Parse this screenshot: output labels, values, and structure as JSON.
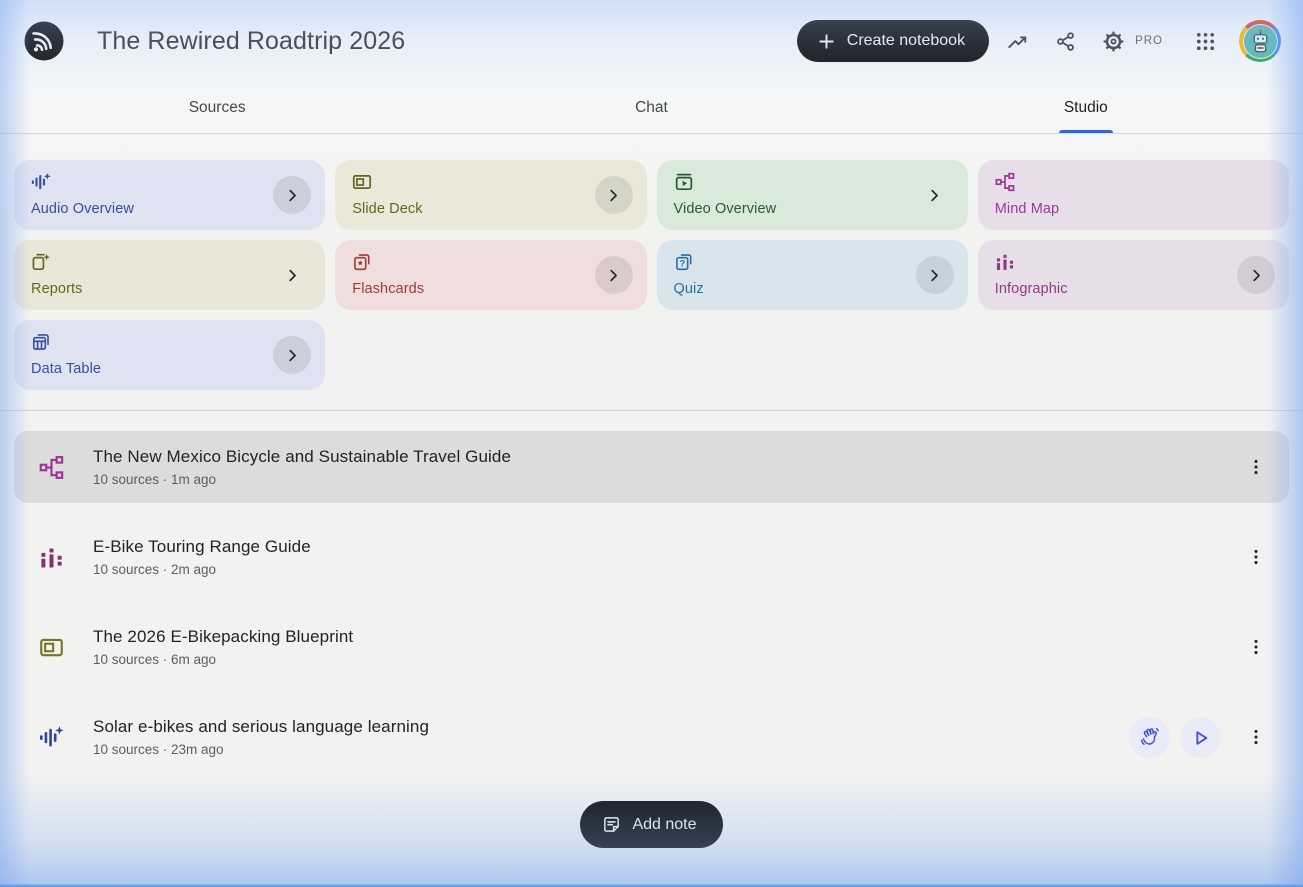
{
  "header": {
    "title": "The Rewired Roadtrip 2026",
    "create_notebook_label": "Create notebook",
    "pro_badge": "PRO"
  },
  "tabs": [
    {
      "label": "Sources",
      "active": false
    },
    {
      "label": "Chat",
      "active": false
    },
    {
      "label": "Studio",
      "active": true
    }
  ],
  "studio_cards": [
    {
      "label": "Audio Overview",
      "icon": "audio-overview-icon",
      "bg": "#dfe2f1",
      "fg": "#3a4e94",
      "chevron": "circle"
    },
    {
      "label": "Slide Deck",
      "icon": "slide-deck-icon",
      "bg": "#e9e8d9",
      "fg": "#6b6420",
      "chevron": "circle"
    },
    {
      "label": "Video Overview",
      "icon": "video-overview-icon",
      "bg": "#d9e9da",
      "fg": "#2c5932",
      "chevron": "plain"
    },
    {
      "label": "Mind Map",
      "icon": "mind-map-icon",
      "bg": "#e8dee8",
      "fg": "#99399a",
      "chevron": "none"
    },
    {
      "label": "Reports",
      "icon": "reports-icon",
      "bg": "#e8e7d8",
      "fg": "#6b6420",
      "chevron": "plain"
    },
    {
      "label": "Flashcards",
      "icon": "flashcards-icon",
      "bg": "#f0dddd",
      "fg": "#9e3b38",
      "chevron": "circle"
    },
    {
      "label": "Quiz",
      "icon": "quiz-icon",
      "bg": "#d8e5ed",
      "fg": "#2b6f9e",
      "chevron": "circle"
    },
    {
      "label": "Infographic",
      "icon": "infographic-icon",
      "bg": "#e7dfe7",
      "fg": "#8f3a88",
      "chevron": "circle"
    },
    {
      "label": "Data Table",
      "icon": "data-table-icon",
      "bg": "#dfe2f0",
      "fg": "#37509b",
      "chevron": "circle"
    }
  ],
  "artifacts": [
    {
      "title": "The New Mexico Bicycle and Sustainable Travel Guide",
      "meta": "10 sources · 1m ago",
      "icon": "mind-map-icon",
      "icon_color": "#9c3397",
      "highlighted": true,
      "actions": []
    },
    {
      "title": "E-Bike Touring Range Guide",
      "meta": "10 sources · 2m ago",
      "icon": "infographic-icon",
      "icon_color": "#8a2f6e",
      "highlighted": false,
      "actions": []
    },
    {
      "title": "The 2026 E-Bikepacking Blueprint",
      "meta": "10 sources · 6m ago",
      "icon": "slide-deck-icon",
      "icon_color": "#7a7226",
      "highlighted": false,
      "actions": []
    },
    {
      "title": "Solar e-bikes and serious language learning",
      "meta": "10 sources · 23m ago",
      "icon": "audio-overview-icon",
      "icon_color": "#2f4894",
      "highlighted": false,
      "actions": [
        "interactive-audio",
        "play"
      ]
    }
  ],
  "add_note_label": "Add note",
  "colors": {
    "tab_active_underline": "#2a68dc",
    "dark_button_bg": "#131314",
    "highlight_row_bg": "#dcdcdb",
    "action_circle_bg": "#e9ebf9",
    "action_icon": "#4554cf",
    "edge_glow_blue": "#76a3ee",
    "page_bg": "#f2f2f1"
  }
}
